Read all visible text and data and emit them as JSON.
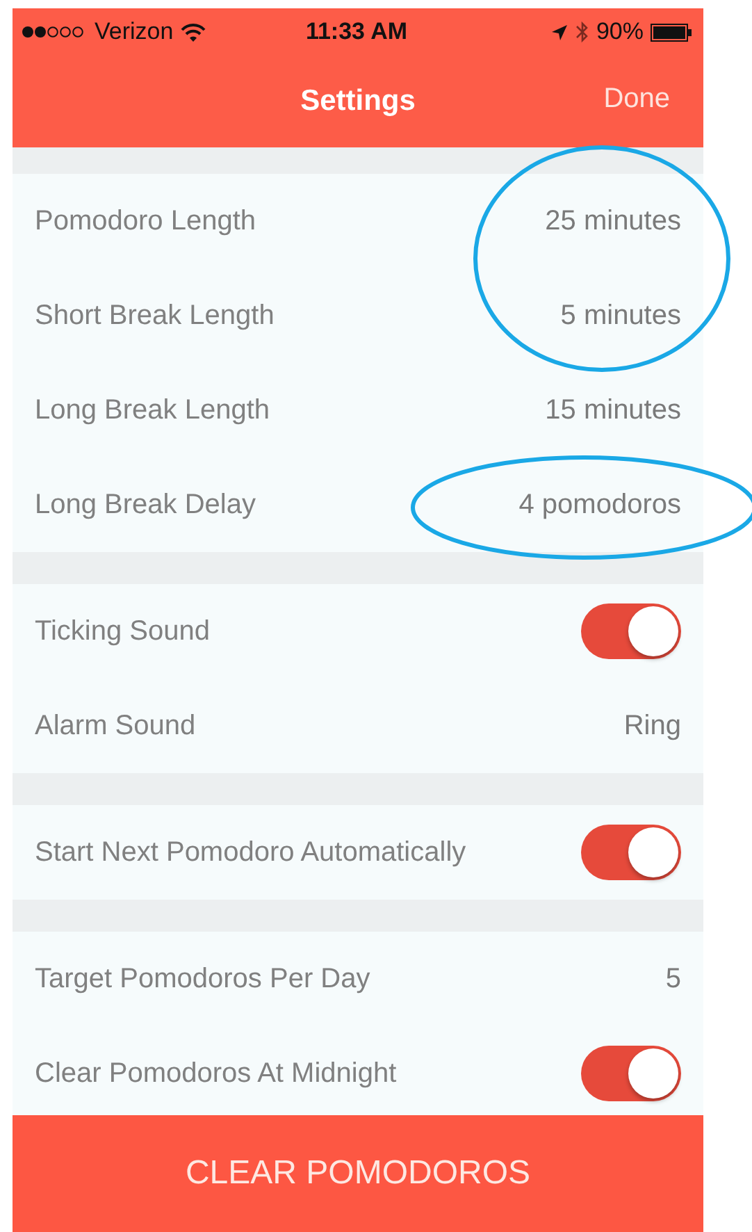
{
  "status_bar": {
    "carrier": "Verizon",
    "time": "11:33 AM",
    "battery": "90%"
  },
  "nav_bar": {
    "title": "Settings",
    "action": "Done"
  },
  "sections": [
    {
      "rows": [
        {
          "kind": "value",
          "label": "Pomodoro Length",
          "value": "25 minutes"
        },
        {
          "kind": "value",
          "label": "Short Break Length",
          "value": "5 minutes"
        },
        {
          "kind": "value",
          "label": "Long Break Length",
          "value": "15 minutes"
        },
        {
          "kind": "value",
          "label": "Long Break Delay",
          "value": "4 pomodoros"
        }
      ]
    },
    {
      "rows": [
        {
          "kind": "toggle",
          "label": "Ticking Sound",
          "on": true
        },
        {
          "kind": "value",
          "label": "Alarm Sound",
          "value": "Ring"
        }
      ]
    },
    {
      "rows": [
        {
          "kind": "toggle",
          "label": "Start Next Pomodoro Automatically",
          "on": true
        }
      ]
    },
    {
      "rows": [
        {
          "kind": "value",
          "label": "Target Pomodoros Per Day",
          "value": "5"
        },
        {
          "kind": "toggle",
          "label": "Clear Pomodoros At Midnight",
          "on": true
        }
      ]
    }
  ],
  "clear_button": "CLEAR POMODOROS"
}
